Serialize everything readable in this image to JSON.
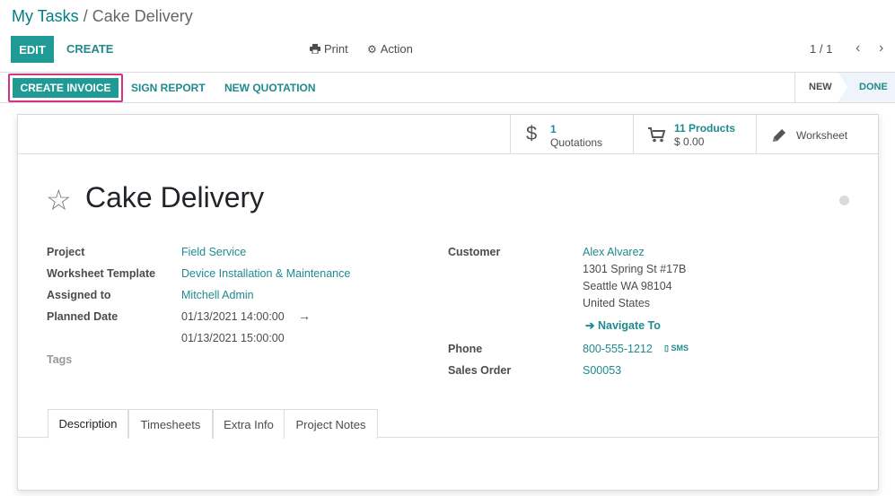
{
  "breadcrumb": {
    "parent": "My Tasks",
    "separator": "/",
    "current": "Cake Delivery"
  },
  "toolbar": {
    "edit": "EDIT",
    "create": "CREATE",
    "print": "Print",
    "action": "Action",
    "pager": "1 / 1",
    "prev": "‹",
    "next": "›"
  },
  "statusbar": {
    "buttons": [
      "CREATE INVOICE",
      "SIGN REPORT",
      "NEW QUOTATION"
    ],
    "stages": [
      "NEW",
      "DONE"
    ]
  },
  "smart_buttons": {
    "quotations": {
      "count": "1",
      "label": "Quotations",
      "icon": "dollar-icon"
    },
    "products": {
      "count": "11 Products",
      "amount": "$ 0.00",
      "icon": "cart-icon"
    },
    "worksheet": {
      "label": "Worksheet",
      "icon": "pencil-icon"
    }
  },
  "record": {
    "title": "Cake Delivery"
  },
  "left_fields": {
    "project_label": "Project",
    "project": "Field Service",
    "template_label": "Worksheet Template",
    "template": "Device Installation & Maintenance",
    "assigned_label": "Assigned to",
    "assigned": "Mitchell Admin",
    "planned_label": "Planned Date",
    "planned_start": "01/13/2021 14:00:00",
    "planned_arrow": "→",
    "planned_end": "01/13/2021 15:00:00",
    "tags_label": "Tags"
  },
  "right_fields": {
    "customer_label": "Customer",
    "customer": "Alex Alvarez",
    "address1": "1301 Spring St #17B",
    "address2": "Seattle WA 98104",
    "address3": "United States",
    "navigate": "Navigate To",
    "phone_label": "Phone",
    "phone": "800-555-1212",
    "sms": "SMS",
    "sales_order_label": "Sales Order",
    "sales_order": "S00053"
  },
  "tabs": [
    "Description",
    "Timesheets",
    "Extra Info",
    "Project Notes"
  ],
  "colors": {
    "primary": "#1f9a94",
    "link": "#1f8a8f",
    "highlight": "#d63384"
  }
}
